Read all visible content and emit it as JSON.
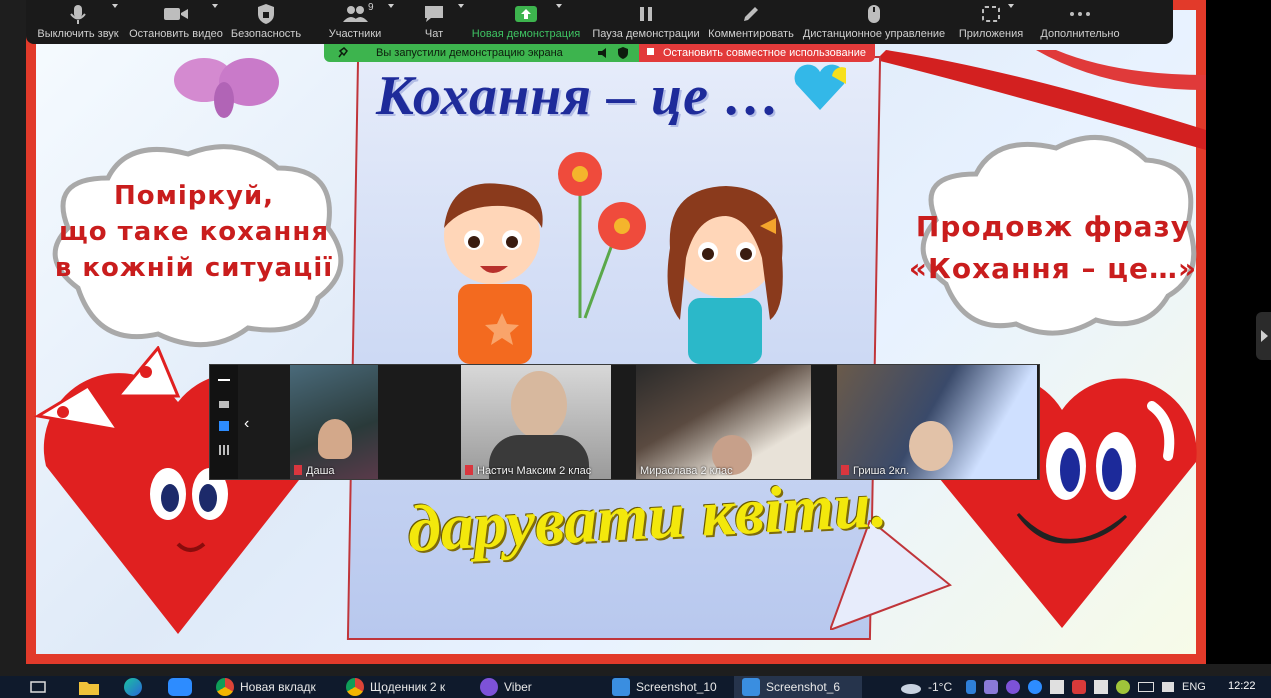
{
  "toolbar": {
    "mute": "Выключить звук",
    "video": "Остановить видео",
    "security": "Безопасность",
    "participants": "Участники",
    "participants_count": "9",
    "chat": "Чат",
    "new_share": "Новая демонстрация",
    "pause_share": "Пауза демонстрации",
    "annotate": "Комментировать",
    "remote_control": "Дистанционное управление",
    "apps": "Приложения",
    "more": "Дополнительно"
  },
  "share_banner": {
    "message": "Вы запустили демонстрацию экрана",
    "stop": "Остановить совместное использование"
  },
  "slide": {
    "title_top": "Кохання – це …",
    "title_bottom": "дарувати квіти.",
    "left_cloud": [
      "Поміркуй,",
      "що таке кохання",
      "в кожній ситуації"
    ],
    "right_cloud": [
      "Продовж фразу",
      "«Кохання – це…»"
    ]
  },
  "participants": [
    {
      "name": "Даша",
      "muted": true
    },
    {
      "name": "Настич Максим 2 клас",
      "muted": true
    },
    {
      "name": "Мираслава 2 клас",
      "muted": false
    },
    {
      "name": "Гриша 2кл.",
      "muted": true
    }
  ],
  "taskbar": {
    "apps": [
      "Новая вкладк",
      "Щоденник 2 к",
      "Viber",
      "Screenshot_10",
      "Screenshot_6"
    ],
    "weather": "-1°C",
    "lang": "ENG",
    "time": "12:22"
  },
  "colors": {
    "accent_green": "#3db44e",
    "stop_red": "#e23a3a",
    "slide_border": "#e23a2a",
    "title_blue": "#1e2b9a",
    "title_yellow": "#f3e80c"
  }
}
